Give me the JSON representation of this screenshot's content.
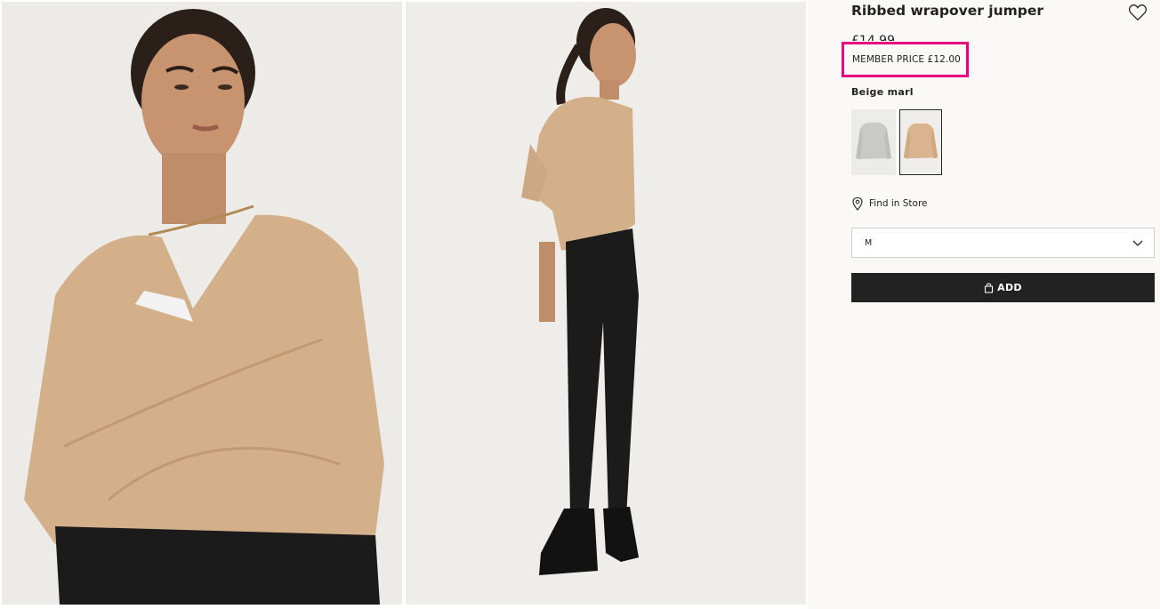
{
  "product": {
    "title": "Ribbed wrapover jumper",
    "price": "£14.99",
    "member_price": "MEMBER PRICE £12.00",
    "color_name": "Beige marl"
  },
  "swatches": [
    {
      "name": "grey",
      "color": "#c9c9c7"
    },
    {
      "name": "beige",
      "color": "#d9b48e"
    }
  ],
  "find_in_store": "Find in Store",
  "size_select": {
    "value": "M"
  },
  "add_button": {
    "label": "ADD"
  },
  "colors": {
    "highlight": "#e5007e",
    "add_button_bg": "#222222",
    "sweater": "#d4b08a",
    "trousers": "#1c1b1b"
  },
  "icons": {
    "favorite": "heart-outline-icon",
    "store": "location-pin-icon",
    "dropdown": "chevron-down-icon",
    "add": "shopping-bag-icon"
  }
}
